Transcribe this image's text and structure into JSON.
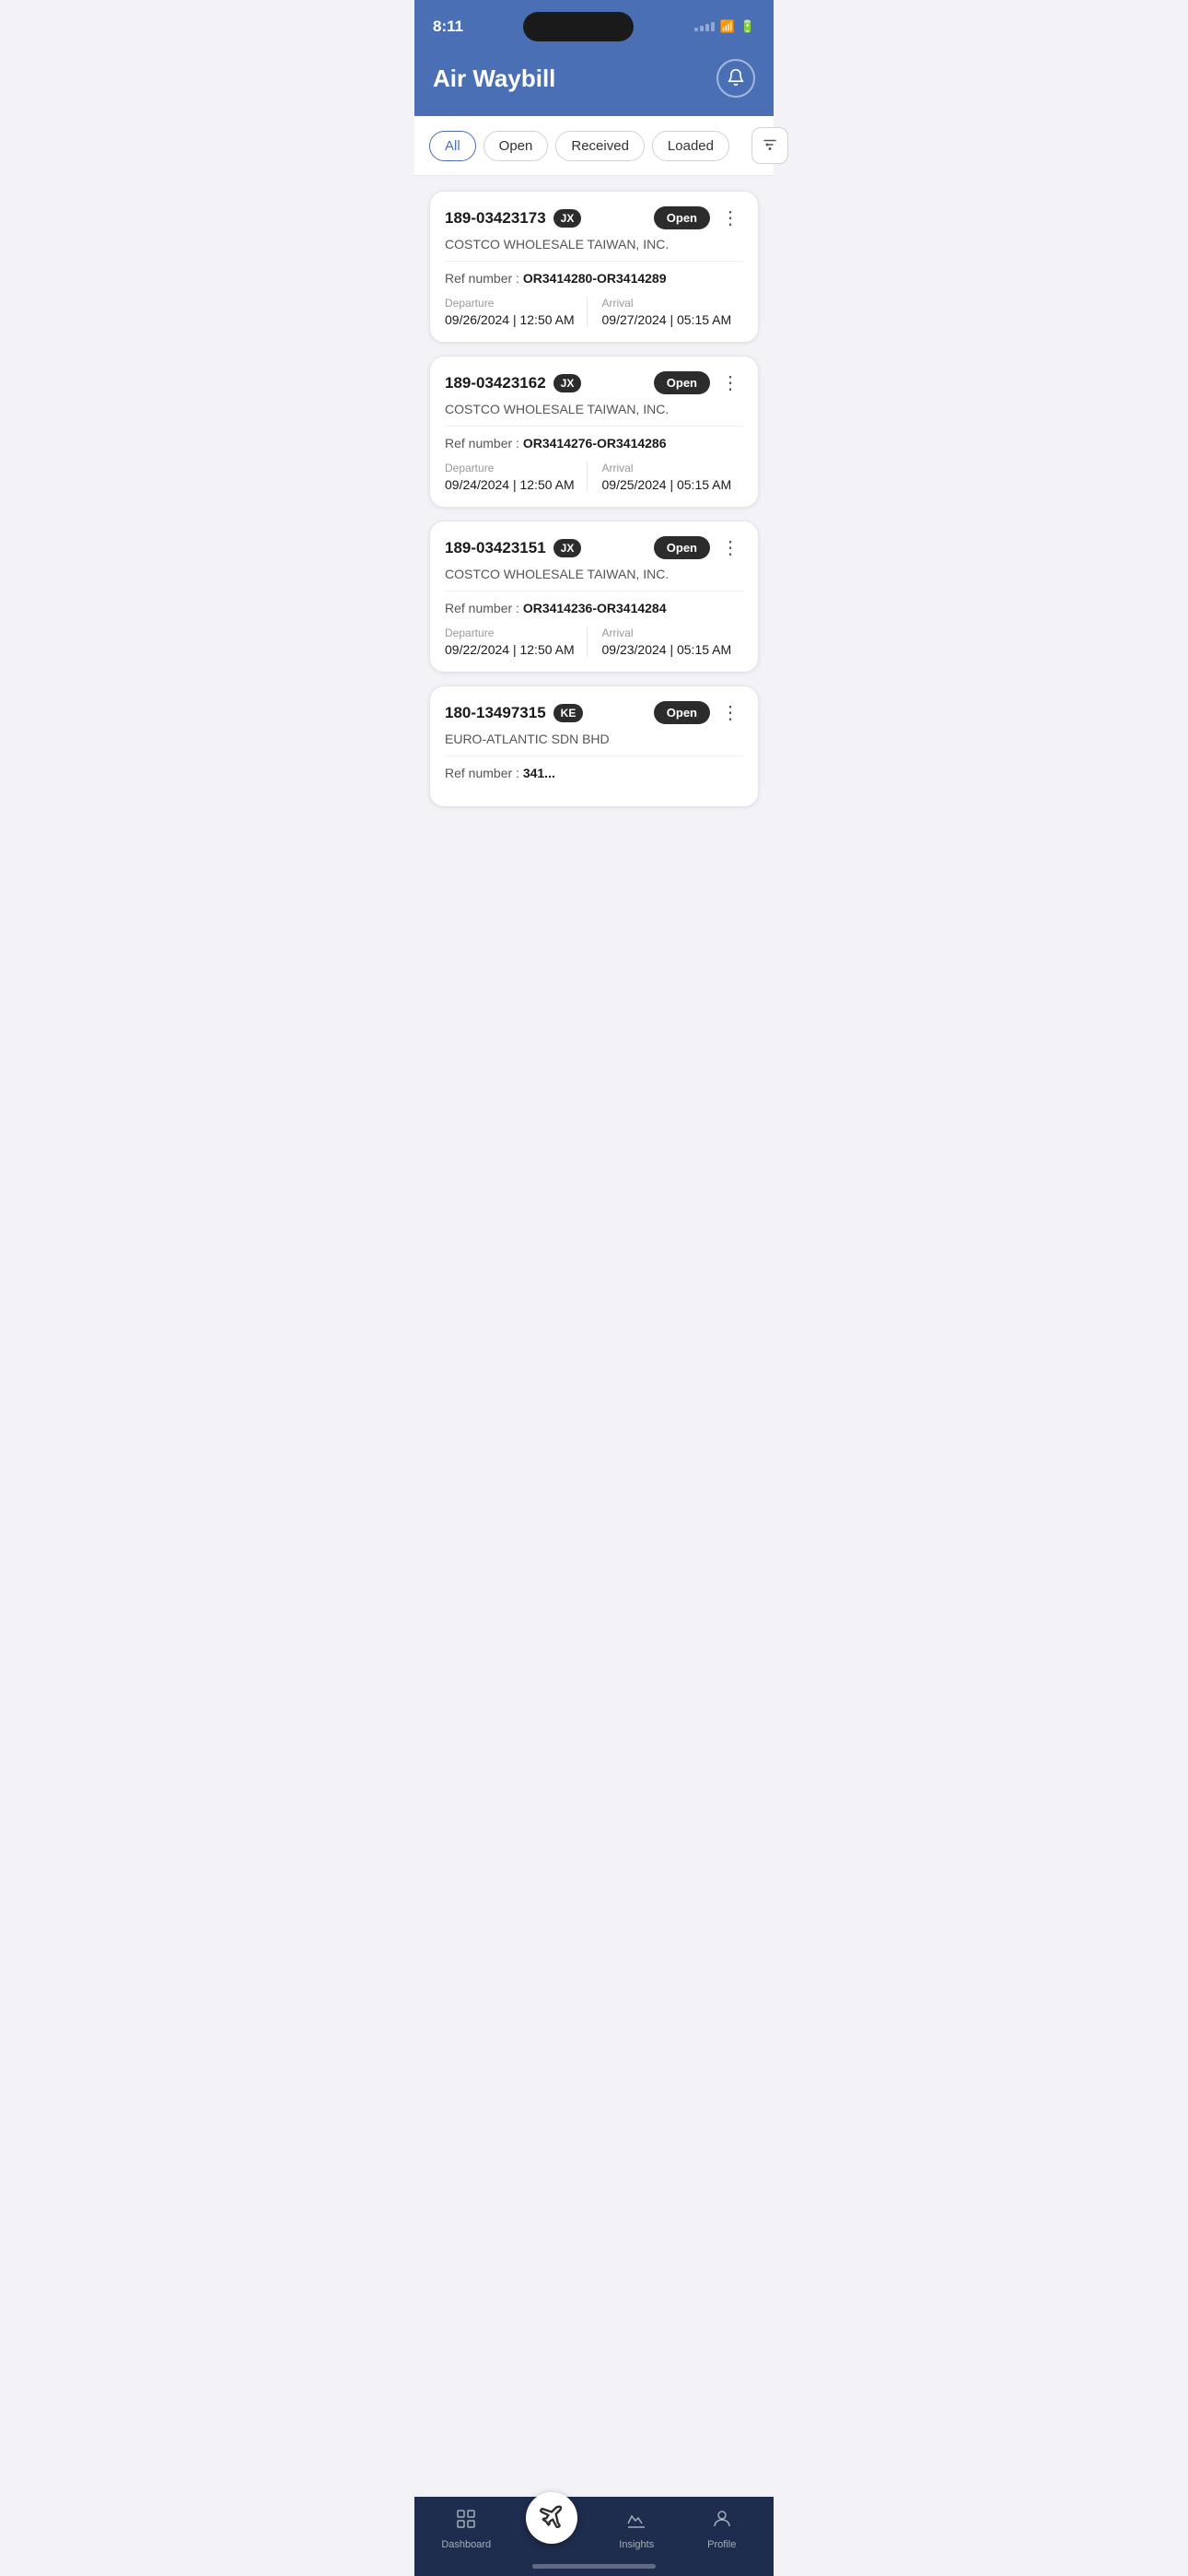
{
  "statusBar": {
    "time": "8:11"
  },
  "header": {
    "title": "Air Waybill",
    "bellLabel": "notifications"
  },
  "filterBar": {
    "pills": [
      {
        "id": "all",
        "label": "All",
        "active": true
      },
      {
        "id": "open",
        "label": "Open",
        "active": false
      },
      {
        "id": "received",
        "label": "Received",
        "active": false
      },
      {
        "id": "loaded",
        "label": "Loaded",
        "active": false
      }
    ]
  },
  "cards": [
    {
      "id": "189-03423173",
      "carrier": "JX",
      "status": "Open",
      "company": "COSTCO WHOLESALE TAIWAN, INC.",
      "refLabel": "Ref number : ",
      "refNumber": "OR3414280-OR3414289",
      "departure": {
        "label": "Departure",
        "date": "09/26/2024",
        "time": "12:50 AM"
      },
      "arrival": {
        "label": "Arrival",
        "date": "09/27/2024",
        "time": "05:15 AM"
      }
    },
    {
      "id": "189-03423162",
      "carrier": "JX",
      "status": "Open",
      "company": "COSTCO WHOLESALE TAIWAN, INC.",
      "refLabel": "Ref number : ",
      "refNumber": "OR3414276-OR3414286",
      "departure": {
        "label": "Departure",
        "date": "09/24/2024",
        "time": "12:50 AM"
      },
      "arrival": {
        "label": "Arrival",
        "date": "09/25/2024",
        "time": "05:15 AM"
      }
    },
    {
      "id": "189-03423151",
      "carrier": "JX",
      "status": "Open",
      "company": "COSTCO WHOLESALE TAIWAN, INC.",
      "refLabel": "Ref number : ",
      "refNumber": "OR3414236-OR3414284",
      "departure": {
        "label": "Departure",
        "date": "09/22/2024",
        "time": "12:50 AM"
      },
      "arrival": {
        "label": "Arrival",
        "date": "09/23/2024",
        "time": "05:15 AM"
      }
    },
    {
      "id": "180-13497315",
      "carrier": "KE",
      "status": "Open",
      "company": "EURO-ATLANTIC SDN BHD",
      "refLabel": "Ref number : ",
      "refNumber": "341...",
      "departure": null,
      "arrival": null,
      "partial": true
    }
  ],
  "bottomNav": {
    "items": [
      {
        "id": "dashboard",
        "label": "Dashboard",
        "icon": "dashboard"
      },
      {
        "id": "airwaybill",
        "label": "",
        "icon": "plane",
        "center": true
      },
      {
        "id": "insights",
        "label": "Insights",
        "icon": "insights"
      },
      {
        "id": "profile",
        "label": "Profile",
        "icon": "profile"
      }
    ]
  }
}
